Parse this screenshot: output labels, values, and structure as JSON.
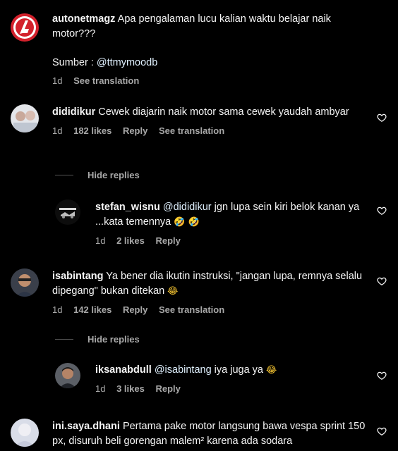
{
  "post": {
    "username": "autonetmagz",
    "caption": "Apa pengalaman lucu kalian waktu belajar naik motor???",
    "source_label": "Sumber : ",
    "source_mention": "@ttmymoodb",
    "time": "1d",
    "see_translation": "See translation"
  },
  "comments": [
    {
      "username": "dididikur",
      "text": "Cewek diajarin naik motor sama cewek yaudah ambyar",
      "time": "1d",
      "likes": "182 likes",
      "reply": "Reply",
      "see_translation": "See translation",
      "hide_replies": "Hide replies",
      "replies": [
        {
          "username": "stefan_wisnu",
          "mention": "@dididikur",
          "text": " jgn lupa sein kiri belok kanan ya ...kata temennya ",
          "emoji": "🤣 🤣",
          "time": "1d",
          "likes": "2 likes",
          "reply": "Reply"
        }
      ]
    },
    {
      "username": "isabintang",
      "text": "Ya bener dia ikutin instruksi, \"jangan lupa, remnya selalu dipegang\" bukan ditekan ",
      "emoji": "😂",
      "time": "1d",
      "likes": "142 likes",
      "reply": "Reply",
      "see_translation": "See translation",
      "hide_replies": "Hide replies",
      "replies": [
        {
          "username": "iksanabdull",
          "mention": "@isabintang",
          "text": " iya juga ya ",
          "emoji": "😂",
          "time": "1d",
          "likes": "3 likes",
          "reply": "Reply"
        }
      ]
    },
    {
      "username": "ini.saya.dhani",
      "text": "Pertama pake motor langsung bawa vespa sprint 150 px, disuruh beli gorengan malem² karena ada sodara"
    }
  ],
  "icons": {
    "heart": "heart-outline-icon",
    "brand_color": "#d3212c"
  }
}
